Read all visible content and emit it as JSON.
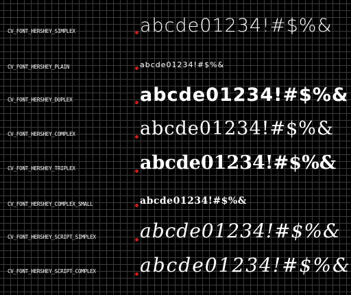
{
  "rows": [
    {
      "label": "CV_FONT_HERSHEY_SIMPLEX",
      "sample": "abcde01234!#$%&"
    },
    {
      "label": "CV_FONT_HERSHEY_PLAIN",
      "sample": "abcde01234!#$%&"
    },
    {
      "label": "CV_FONT_HERSHEY_DUPLEX",
      "sample": "abcde01234!#$%&"
    },
    {
      "label": "CV_FONT_HERSHEY_COMPLEX",
      "sample": "abcde01234!#$%&"
    },
    {
      "label": "CV_FONT_HERSHEY_TRIPLEX",
      "sample": "abcde01234!#$%&"
    },
    {
      "label": "CV_FONT_HERSHEY_COMPLEX_SMALL",
      "sample": "abcde01234!#$%&"
    },
    {
      "label": "CV_FONT_HERSHEY_SCRIPT_SIMPLEX",
      "sample": "abcde01234!#$%&"
    },
    {
      "label": "CV_FONT_HERSHEY_SCRIPT_COMPLEX",
      "sample": "abcde01234!#$%&"
    }
  ],
  "colors": {
    "background": "#000000",
    "grid": "#3c3c3c",
    "text": "#ffffff",
    "origin_marker": "#c81e1e"
  }
}
